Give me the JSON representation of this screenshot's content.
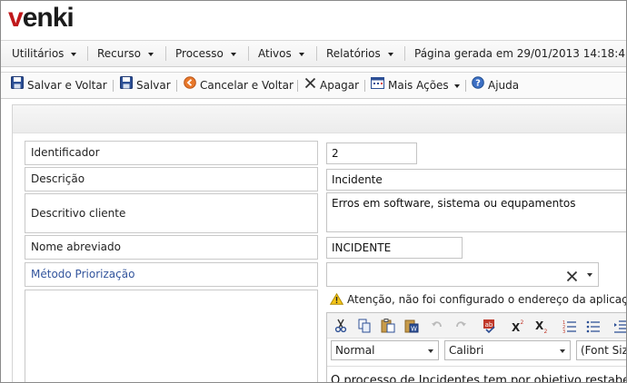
{
  "brand": {
    "logo_text": "venki"
  },
  "menubar": {
    "items": [
      "Utilitários",
      "Recurso",
      "Processo",
      "Ativos",
      "Relatórios"
    ],
    "page_generated": "Página gerada em 29/01/2013 14:18:47"
  },
  "toolbar": {
    "save_back": "Salvar e Voltar",
    "save": "Salvar",
    "cancel_back": "Cancelar e Voltar",
    "delete": "Apagar",
    "more_actions": "Mais Ações",
    "help": "Ajuda"
  },
  "form": {
    "identificador_label": "Identificador",
    "identificador_value": "2",
    "descricao_label": "Descrição",
    "descricao_value": "Incidente",
    "descritivo_label": "Descritivo cliente",
    "descritivo_value": "Erros em software, sistema ou equpamentos",
    "nome_abreviado_label": "Nome abreviado",
    "nome_abreviado_value": "INCIDENTE",
    "metodo_label": "Método Priorização",
    "metodo_value": ""
  },
  "warning": {
    "text": "Atenção, não foi configurado o endereço da aplicação"
  },
  "editor": {
    "format_value": "Normal",
    "font_value": "Calibri",
    "size_value": "(Font Size)",
    "body_text": "O processo de Incidentes tem por objetivo restabelecer"
  },
  "colors": {
    "brand_red": "#c0181b",
    "link_blue": "#33559d"
  }
}
